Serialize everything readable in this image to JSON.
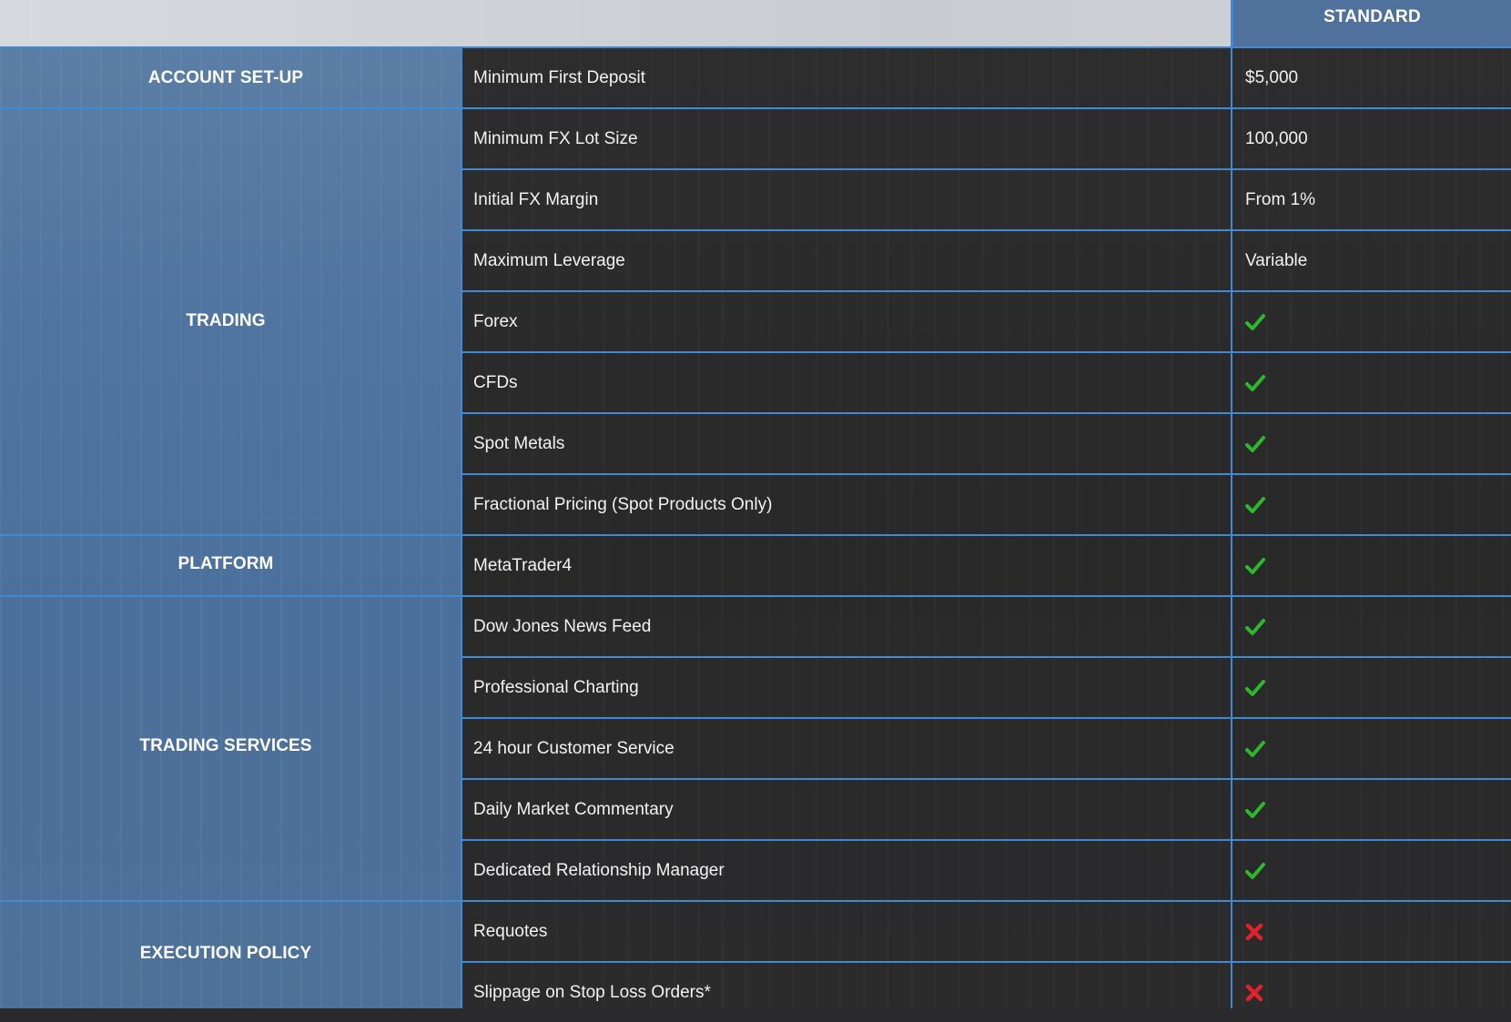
{
  "header": {
    "plan_label": "STANDARD"
  },
  "categories": [
    {
      "label": "ACCOUNT SET-UP"
    },
    {
      "label": "TRADING"
    },
    {
      "label": "PLATFORM"
    },
    {
      "label": "TRADING SERVICES"
    },
    {
      "label": "EXECUTION POLICY"
    }
  ],
  "rows": [
    {
      "feature": "Minimum First Deposit",
      "value": "$5,000",
      "icon": ""
    },
    {
      "feature": "Minimum FX Lot Size",
      "value": "100,000",
      "icon": ""
    },
    {
      "feature": "Initial FX Margin",
      "value": "From 1%",
      "icon": ""
    },
    {
      "feature": "Maximum Leverage",
      "value": "Variable",
      "icon": ""
    },
    {
      "feature": "Forex",
      "value": "",
      "icon": "check-icon"
    },
    {
      "feature": "CFDs",
      "value": "",
      "icon": "check-icon"
    },
    {
      "feature": "Spot Metals",
      "value": "",
      "icon": "check-icon"
    },
    {
      "feature": "Fractional Pricing (Spot Products Only)",
      "value": "",
      "icon": "check-icon"
    },
    {
      "feature": "MetaTrader4",
      "value": "",
      "icon": "check-icon"
    },
    {
      "feature": "Dow Jones News Feed",
      "value": "",
      "icon": "check-icon"
    },
    {
      "feature": "Professional Charting",
      "value": "",
      "icon": "check-icon"
    },
    {
      "feature": "24 hour Customer Service",
      "value": "",
      "icon": "check-icon"
    },
    {
      "feature": "Daily Market Commentary",
      "value": "",
      "icon": "check-icon"
    },
    {
      "feature": "Dedicated Relationship Manager",
      "value": "",
      "icon": "check-icon"
    },
    {
      "feature": "Requotes",
      "value": "",
      "icon": "cross-icon"
    },
    {
      "feature": "Slippage on Stop Loss Orders*",
      "value": "",
      "icon": "cross-icon"
    }
  ],
  "colors": {
    "accent_line": "#3f8ad2",
    "category_bg": "#4f74a0",
    "row_bg": "#2b2b2c",
    "check": "#2db82d",
    "cross": "#e0222a"
  }
}
